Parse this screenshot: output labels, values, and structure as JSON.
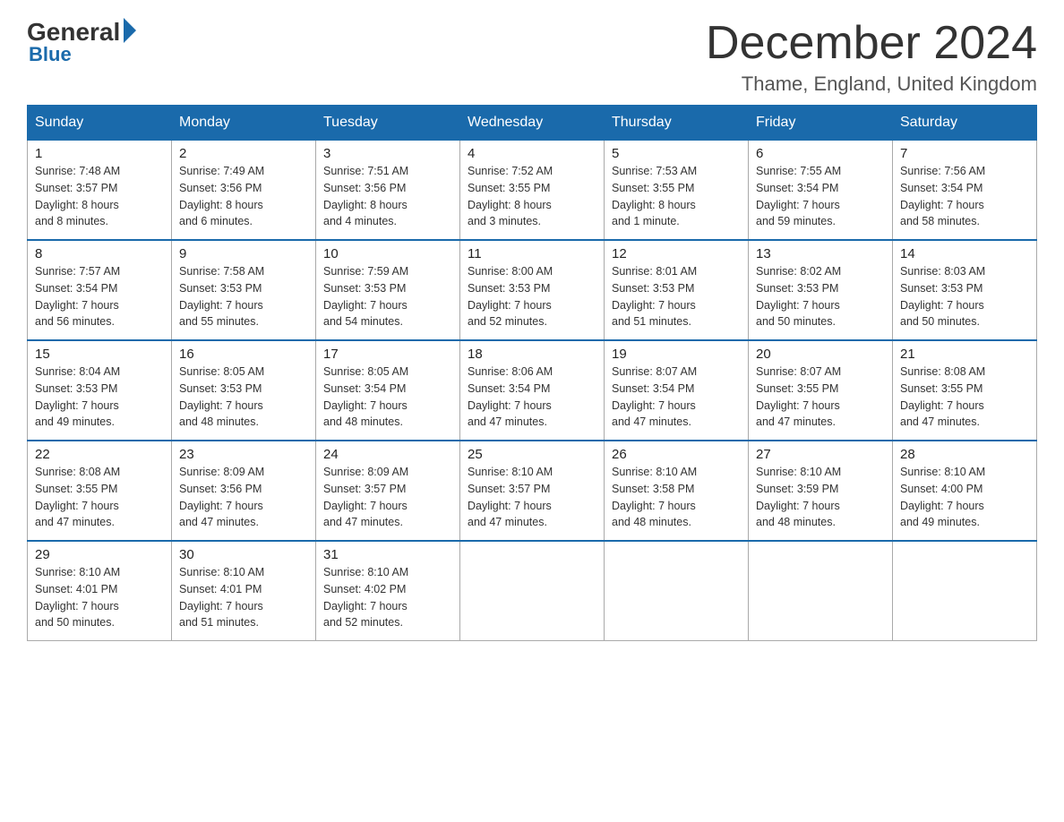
{
  "header": {
    "logo_general": "General",
    "logo_blue": "Blue",
    "month_title": "December 2024",
    "location": "Thame, England, United Kingdom"
  },
  "days_of_week": [
    "Sunday",
    "Monday",
    "Tuesday",
    "Wednesday",
    "Thursday",
    "Friday",
    "Saturday"
  ],
  "weeks": [
    [
      {
        "num": "1",
        "info": "Sunrise: 7:48 AM\nSunset: 3:57 PM\nDaylight: 8 hours\nand 8 minutes."
      },
      {
        "num": "2",
        "info": "Sunrise: 7:49 AM\nSunset: 3:56 PM\nDaylight: 8 hours\nand 6 minutes."
      },
      {
        "num": "3",
        "info": "Sunrise: 7:51 AM\nSunset: 3:56 PM\nDaylight: 8 hours\nand 4 minutes."
      },
      {
        "num": "4",
        "info": "Sunrise: 7:52 AM\nSunset: 3:55 PM\nDaylight: 8 hours\nand 3 minutes."
      },
      {
        "num": "5",
        "info": "Sunrise: 7:53 AM\nSunset: 3:55 PM\nDaylight: 8 hours\nand 1 minute."
      },
      {
        "num": "6",
        "info": "Sunrise: 7:55 AM\nSunset: 3:54 PM\nDaylight: 7 hours\nand 59 minutes."
      },
      {
        "num": "7",
        "info": "Sunrise: 7:56 AM\nSunset: 3:54 PM\nDaylight: 7 hours\nand 58 minutes."
      }
    ],
    [
      {
        "num": "8",
        "info": "Sunrise: 7:57 AM\nSunset: 3:54 PM\nDaylight: 7 hours\nand 56 minutes."
      },
      {
        "num": "9",
        "info": "Sunrise: 7:58 AM\nSunset: 3:53 PM\nDaylight: 7 hours\nand 55 minutes."
      },
      {
        "num": "10",
        "info": "Sunrise: 7:59 AM\nSunset: 3:53 PM\nDaylight: 7 hours\nand 54 minutes."
      },
      {
        "num": "11",
        "info": "Sunrise: 8:00 AM\nSunset: 3:53 PM\nDaylight: 7 hours\nand 52 minutes."
      },
      {
        "num": "12",
        "info": "Sunrise: 8:01 AM\nSunset: 3:53 PM\nDaylight: 7 hours\nand 51 minutes."
      },
      {
        "num": "13",
        "info": "Sunrise: 8:02 AM\nSunset: 3:53 PM\nDaylight: 7 hours\nand 50 minutes."
      },
      {
        "num": "14",
        "info": "Sunrise: 8:03 AM\nSunset: 3:53 PM\nDaylight: 7 hours\nand 50 minutes."
      }
    ],
    [
      {
        "num": "15",
        "info": "Sunrise: 8:04 AM\nSunset: 3:53 PM\nDaylight: 7 hours\nand 49 minutes."
      },
      {
        "num": "16",
        "info": "Sunrise: 8:05 AM\nSunset: 3:53 PM\nDaylight: 7 hours\nand 48 minutes."
      },
      {
        "num": "17",
        "info": "Sunrise: 8:05 AM\nSunset: 3:54 PM\nDaylight: 7 hours\nand 48 minutes."
      },
      {
        "num": "18",
        "info": "Sunrise: 8:06 AM\nSunset: 3:54 PM\nDaylight: 7 hours\nand 47 minutes."
      },
      {
        "num": "19",
        "info": "Sunrise: 8:07 AM\nSunset: 3:54 PM\nDaylight: 7 hours\nand 47 minutes."
      },
      {
        "num": "20",
        "info": "Sunrise: 8:07 AM\nSunset: 3:55 PM\nDaylight: 7 hours\nand 47 minutes."
      },
      {
        "num": "21",
        "info": "Sunrise: 8:08 AM\nSunset: 3:55 PM\nDaylight: 7 hours\nand 47 minutes."
      }
    ],
    [
      {
        "num": "22",
        "info": "Sunrise: 8:08 AM\nSunset: 3:55 PM\nDaylight: 7 hours\nand 47 minutes."
      },
      {
        "num": "23",
        "info": "Sunrise: 8:09 AM\nSunset: 3:56 PM\nDaylight: 7 hours\nand 47 minutes."
      },
      {
        "num": "24",
        "info": "Sunrise: 8:09 AM\nSunset: 3:57 PM\nDaylight: 7 hours\nand 47 minutes."
      },
      {
        "num": "25",
        "info": "Sunrise: 8:10 AM\nSunset: 3:57 PM\nDaylight: 7 hours\nand 47 minutes."
      },
      {
        "num": "26",
        "info": "Sunrise: 8:10 AM\nSunset: 3:58 PM\nDaylight: 7 hours\nand 48 minutes."
      },
      {
        "num": "27",
        "info": "Sunrise: 8:10 AM\nSunset: 3:59 PM\nDaylight: 7 hours\nand 48 minutes."
      },
      {
        "num": "28",
        "info": "Sunrise: 8:10 AM\nSunset: 4:00 PM\nDaylight: 7 hours\nand 49 minutes."
      }
    ],
    [
      {
        "num": "29",
        "info": "Sunrise: 8:10 AM\nSunset: 4:01 PM\nDaylight: 7 hours\nand 50 minutes."
      },
      {
        "num": "30",
        "info": "Sunrise: 8:10 AM\nSunset: 4:01 PM\nDaylight: 7 hours\nand 51 minutes."
      },
      {
        "num": "31",
        "info": "Sunrise: 8:10 AM\nSunset: 4:02 PM\nDaylight: 7 hours\nand 52 minutes."
      },
      null,
      null,
      null,
      null
    ]
  ]
}
